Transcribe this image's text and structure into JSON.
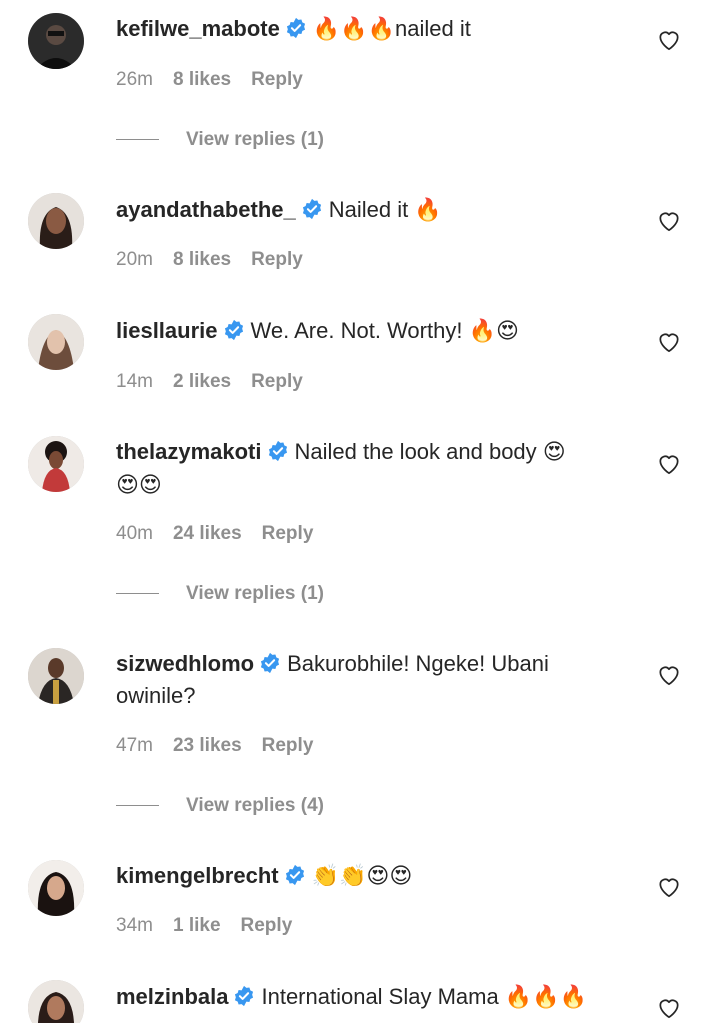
{
  "comments": [
    {
      "username": "kefilwe_mabote",
      "text": "nailed it",
      "emoji_before": "🔥🔥🔥",
      "time": "26m",
      "likes": "8 likes",
      "reply": "Reply",
      "replies": "View replies (1)",
      "avatar_color": "#1b1b1b"
    },
    {
      "username": "ayandathabethe_",
      "text": "Nailed it ",
      "emoji_after": "🔥",
      "time": "20m",
      "likes": "8 likes",
      "reply": "Reply",
      "avatar_color": "#6b4a3a"
    },
    {
      "username": "liesllaurie",
      "text": "We. Are. Not. Worthy! ",
      "emoji_after": "🔥😍",
      "time": "14m",
      "likes": "2 likes",
      "reply": "Reply",
      "avatar_color": "#d8cfc8"
    },
    {
      "username": "thelazymakoti",
      "text": "Nailed the look and body ",
      "emoji_after": "😍",
      "line2": "😍😍",
      "time": "40m",
      "likes": "24 likes",
      "reply": "Reply",
      "replies": "View replies (1)",
      "avatar_color": "#b73a3a"
    },
    {
      "username": "sizwedhlomo",
      "text": "Bakurobhile! Ngeke! Ubani",
      "line2": "owinile?",
      "time": "47m",
      "likes": "23 likes",
      "reply": "Reply",
      "replies": "View replies (4)",
      "avatar_color": "#3c3a36"
    },
    {
      "username": "kimengelbrecht",
      "text": "",
      "emoji_after": "👏👏😍😍",
      "time": "34m",
      "likes": "1 like",
      "reply": "Reply",
      "avatar_color": "#2a2220"
    },
    {
      "username": "melzinbala",
      "text": "International Slay Mama ",
      "emoji_after": "🔥🔥🔥",
      "avatar_color": "#3a2c28"
    }
  ],
  "colors": {
    "text": "#262626",
    "meta": "#8e8e8e",
    "verified": "#3897f0"
  },
  "icons": {
    "verified": "verified-badge-icon",
    "heart": "heart-outline-icon"
  }
}
